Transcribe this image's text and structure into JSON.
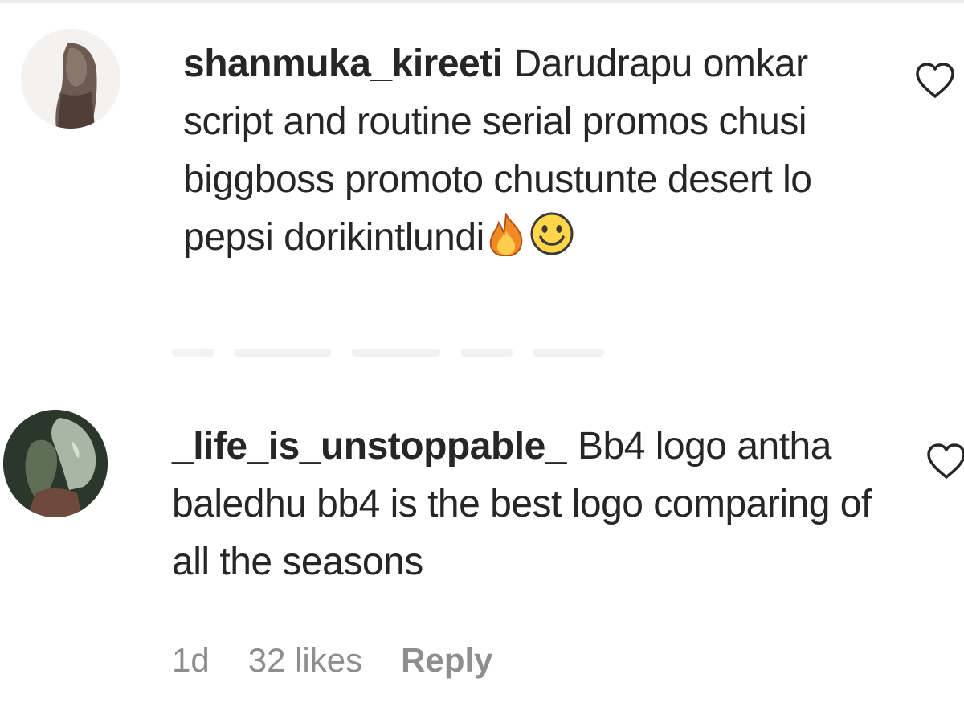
{
  "comments": [
    {
      "username": "shanmuka_kireeti",
      "text": "Darudrapu omkar script and routine serial promos chusi biggboss promoto chustunte desert lo pepsi dorikintlundi",
      "emojis": [
        "fire-emoji",
        "smiley-emoji"
      ],
      "like_icon": "heart-outline-icon"
    },
    {
      "username": "_life_is_unstoppable_",
      "text": "Bb4 logo antha baledhu bb4 is the best logo comparing of all the seasons",
      "like_icon": "heart-outline-icon",
      "meta": {
        "time": "1d",
        "likes": "32 likes",
        "reply": "Reply"
      }
    }
  ],
  "colors": {
    "text": "#262626",
    "meta": "#8e8e8e",
    "background": "#ffffff"
  }
}
